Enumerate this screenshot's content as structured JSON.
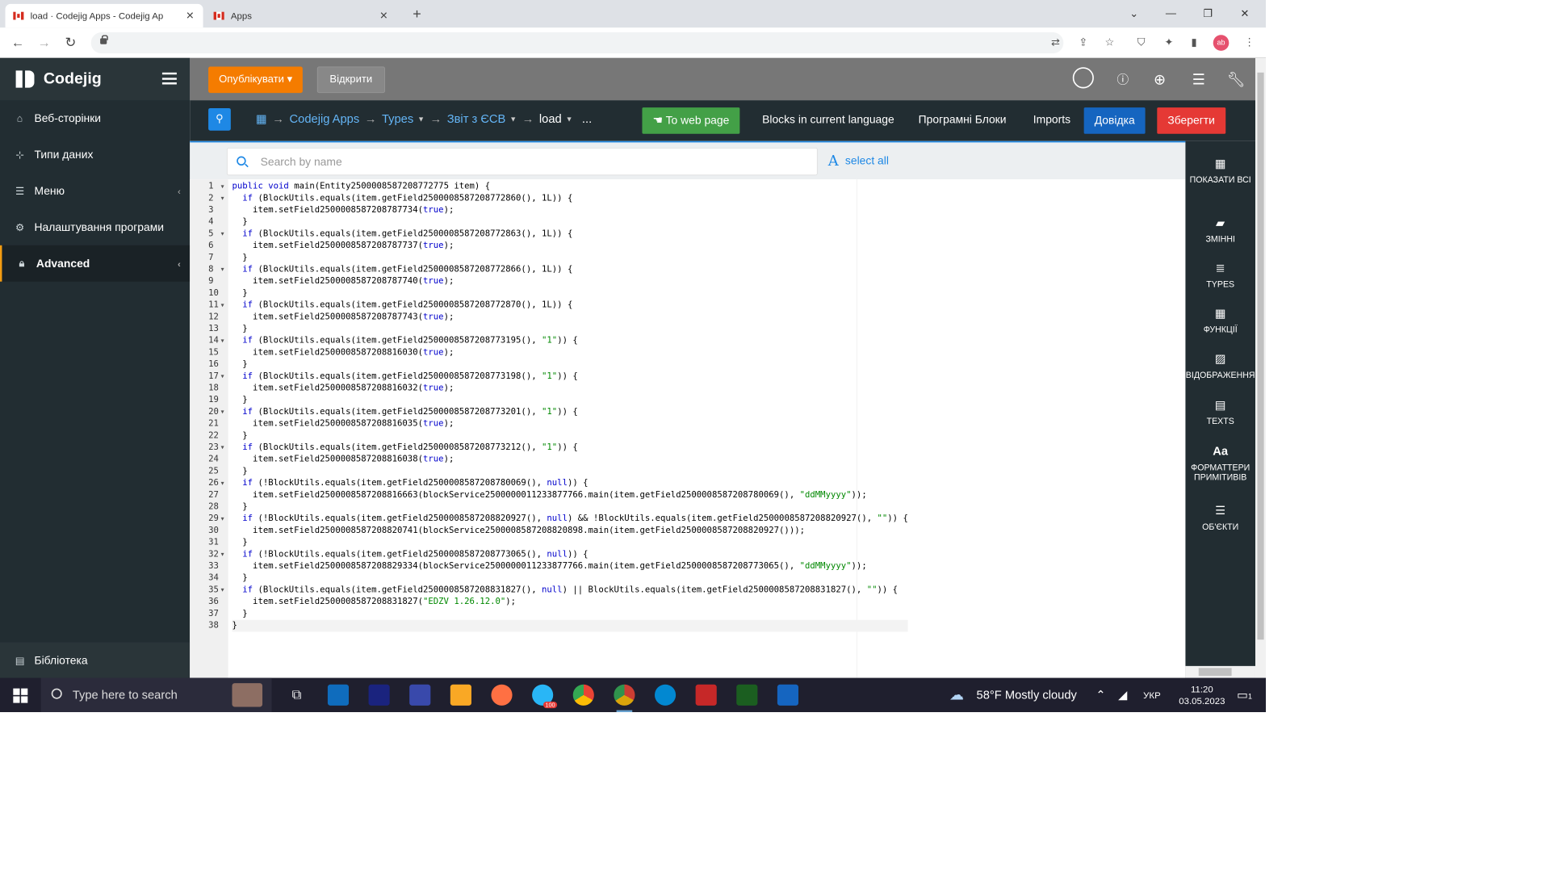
{
  "browser": {
    "tabs": [
      {
        "title": "load · Codejig Apps - Codejig Ap",
        "active": true
      },
      {
        "title": "Apps",
        "active": false
      }
    ],
    "avatar_text": "ab"
  },
  "sidebar": {
    "app_name": "Codejig",
    "items": [
      {
        "label": "Веб-сторінки",
        "icon": "home-icon"
      },
      {
        "label": "Типи даних",
        "icon": "sitemap-icon"
      },
      {
        "label": "Меню",
        "icon": "menu-icon"
      },
      {
        "label": "Налаштування програми",
        "icon": "gear-icon"
      },
      {
        "label": "Advanced",
        "icon": "lock-icon"
      }
    ],
    "library_label": "Бібліотека"
  },
  "topbar": {
    "publish_label": "Опублікувати",
    "open_label": "Відкрити"
  },
  "navbar": {
    "breadcrumbs": [
      "Codejig Apps",
      "Types",
      "Звіт з ЄСВ",
      "load"
    ],
    "more": "...",
    "to_web_page": "To web page",
    "blocks_current_language": "Blocks in current language",
    "program_blocks": "Програмні Блоки",
    "imports": "Imports",
    "help": "Довідка",
    "save": "Зберегти"
  },
  "search": {
    "placeholder": "Search by name",
    "select_all": "select all"
  },
  "right_panel": [
    {
      "label": "ПОКАЗАТИ ВСІ",
      "icon": "table-icon"
    },
    {
      "label": "ЗМІННІ",
      "icon": "book-icon"
    },
    {
      "label": "TYPES",
      "icon": "database-icon"
    },
    {
      "label": "ФУНКЦІЇ",
      "icon": "calculator-icon"
    },
    {
      "label": "ВІДОБРАЖЕННЯ",
      "icon": "image-icon"
    },
    {
      "label": "TEXTS",
      "icon": "file-text-icon"
    },
    {
      "label": "ФОРМАТТЕРИ ПРИМІТИВІВ",
      "icon": "font-icon"
    },
    {
      "label": "ОБ'ЄКТИ",
      "icon": "list-icon"
    }
  ],
  "code_lines": [
    "public void main(Entity2500008587208772775 item) {",
    "  if (BlockUtils.equals(item.getField2500008587208772860(), 1L)) {",
    "    item.setField2500008587208787734(true);",
    "  }",
    "  if (BlockUtils.equals(item.getField2500008587208772863(), 1L)) {",
    "    item.setField2500008587208787737(true);",
    "  }",
    "  if (BlockUtils.equals(item.getField2500008587208772866(), 1L)) {",
    "    item.setField2500008587208787740(true);",
    "  }",
    "  if (BlockUtils.equals(item.getField2500008587208772870(), 1L)) {",
    "    item.setField2500008587208787743(true);",
    "  }",
    "  if (BlockUtils.equals(item.getField2500008587208773195(), \"1\")) {",
    "    item.setField2500008587208816030(true);",
    "  }",
    "  if (BlockUtils.equals(item.getField2500008587208773198(), \"1\")) {",
    "    item.setField2500008587208816032(true);",
    "  }",
    "  if (BlockUtils.equals(item.getField2500008587208773201(), \"1\")) {",
    "    item.setField2500008587208816035(true);",
    "  }",
    "  if (BlockUtils.equals(item.getField2500008587208773212(), \"1\")) {",
    "    item.setField2500008587208816038(true);",
    "  }",
    "  if (!BlockUtils.equals(item.getField2500008587208780069(), null)) {",
    "    item.setField2500008587208816663(blockService2500000011233877766.main(item.getField2500008587208780069(), \"ddMMyyyy\"));",
    "  }",
    "  if (!BlockUtils.equals(item.getField2500008587208820927(), null) && !BlockUtils.equals(item.getField2500008587208820927(), \"\")) {",
    "    item.setField2500008587208820741(blockService2500008587208820898.main(item.getField2500008587208820927()));",
    "  }",
    "  if (!BlockUtils.equals(item.getField2500008587208773065(), null)) {",
    "    item.setField2500008587208829334(blockService2500000011233877766.main(item.getField2500008587208773065(), \"ddMMyyyy\"));",
    "  }",
    "  if (BlockUtils.equals(item.getField2500008587208831827(), null) || BlockUtils.equals(item.getField2500008587208831827(), \"\")) {",
    "    item.setField2500008587208831827(\"EDZV 1.26.12.0\");",
    "  }",
    "}"
  ],
  "fold_lines": [
    1,
    2,
    5,
    8,
    11,
    14,
    17,
    20,
    23,
    26,
    29,
    32,
    35
  ],
  "taskbar": {
    "search_placeholder": "Type here to search",
    "weather": "58°F  Mostly cloudy",
    "language": "УКР",
    "time": "11:20",
    "date": "03.05.2023",
    "telegram_badge": "100",
    "notification_count": "1"
  }
}
